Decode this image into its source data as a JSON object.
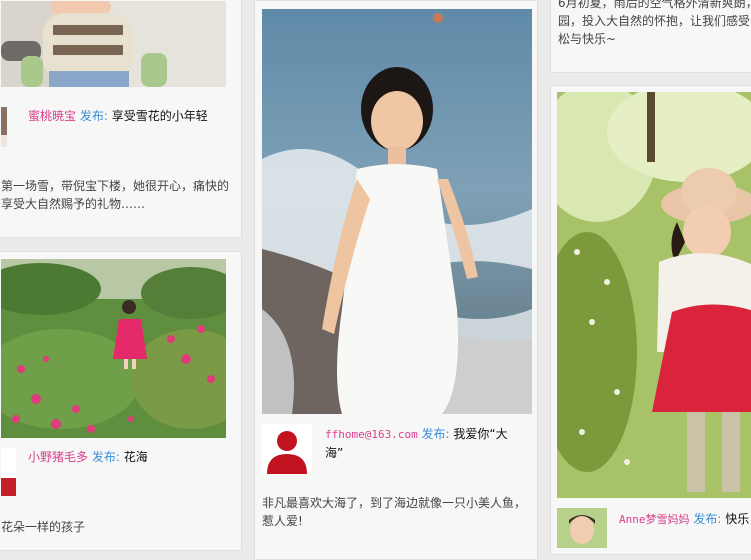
{
  "col1": {
    "post1": {
      "author": "蜜桃暁宝",
      "verb": "发布:",
      "title": "享受雪花的小年轻",
      "desc_line1": "第一场雪，带倪宝下楼，她很开心，痛快的",
      "desc_line2": "享受大自然赐予的礼物……"
    },
    "post2": {
      "author": "小野猪毛多",
      "verb": "发布:",
      "title": "花海",
      "desc": "花朵一样的孩子"
    }
  },
  "col2": {
    "post1": {
      "author": "ffhome@163.com",
      "verb": "发布:",
      "title_line1": "我爱你“大",
      "title_line2": "海”",
      "desc_line1": "非凡最喜欢大海了，到了海边就像一只小美人鱼，",
      "desc_line2": "惹人爱!"
    }
  },
  "col3": {
    "post1": {
      "desc_line1": "6月初夏，雨后的空气格外清新爽朗，",
      "desc_line2": "园，投入大自然的怀抱，让我们感受",
      "desc_line3": "松与快乐~"
    },
    "post2": {
      "author": "Anne梦雪妈妈",
      "verb": "发布:",
      "title": "快乐"
    }
  },
  "colors": {
    "author": "#d9418b",
    "verb": "#3a8ed8",
    "card_bg": "#f7f7f7",
    "page_bg": "#ebebeb"
  }
}
